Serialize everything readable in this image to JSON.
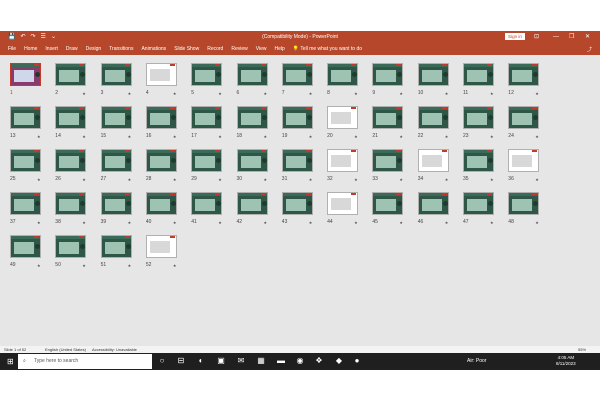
{
  "app": {
    "title": "(Compatibility Mode) - PowerPoint",
    "sign_in": "Sign in",
    "qat": [
      "💾",
      "↶",
      "↷",
      "☰",
      "⌄"
    ],
    "window_controls": [
      "⊡",
      "—",
      "❐",
      "✕"
    ]
  },
  "menu": {
    "items": [
      "File",
      "Home",
      "Insert",
      "Draw",
      "Design",
      "Transitions",
      "Animations",
      "Slide Show",
      "Record",
      "Review",
      "View",
      "Help"
    ],
    "tell_me": "Tell me what you want to do",
    "share": "⤴"
  },
  "slides": {
    "count": 52,
    "selected": 1,
    "per_row": 12,
    "star": "★"
  },
  "statusbar": {
    "slide_info": "Slide 1 of 52",
    "language": "English (United States)",
    "accessibility": "Accessibility: Unavailable",
    "zoom": "55%"
  },
  "taskbar": {
    "start_icon": "⊞",
    "search_icon": "⌕",
    "search_placeholder": "Type here to search",
    "app_icons": [
      "○",
      "⊟",
      "◐",
      "▣",
      "✉",
      "▦",
      "▬",
      "◉",
      "❖",
      "◆",
      "●"
    ],
    "air_quality": "Air: Poor",
    "time": "4:05 AM",
    "date": "8/11/2023"
  },
  "colors": {
    "accent": "#b7472a",
    "selected": "#c43a2a",
    "workspace": "#e6e6e6"
  }
}
